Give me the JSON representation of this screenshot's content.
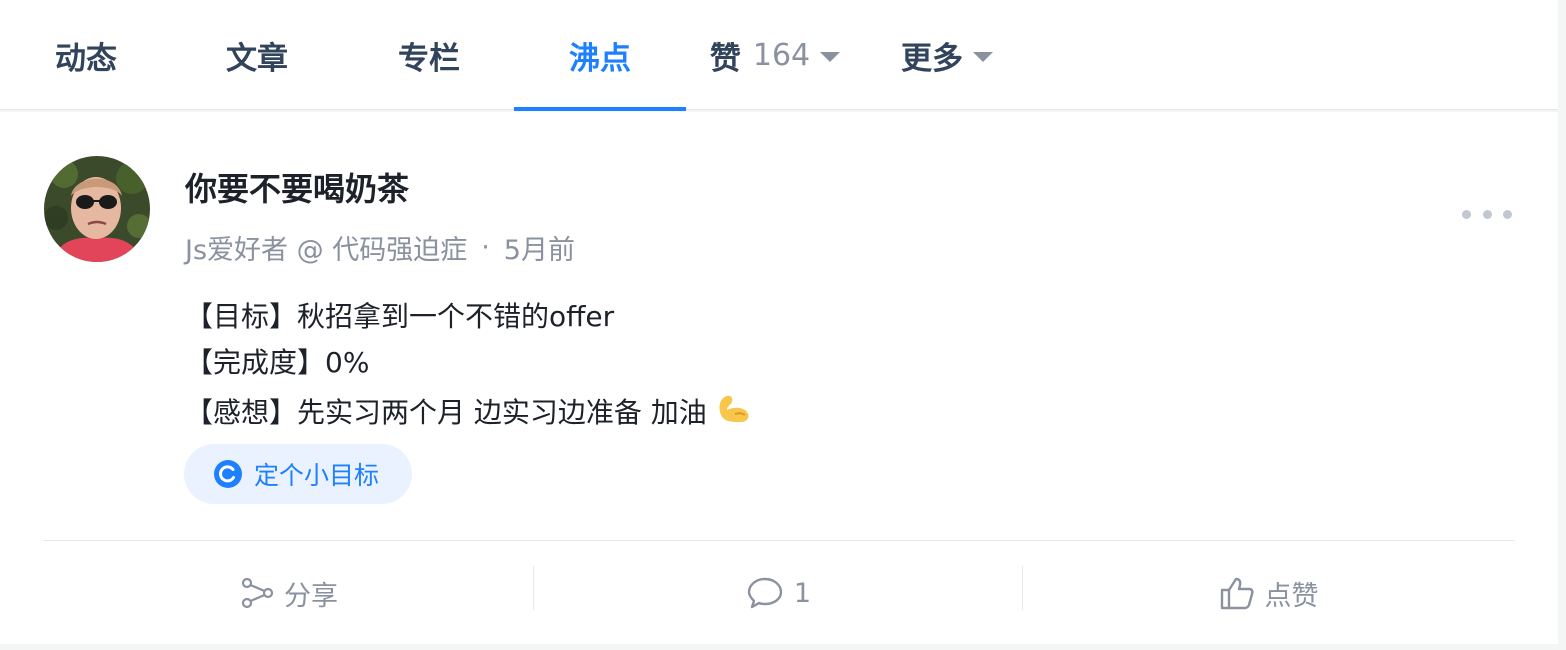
{
  "tabs": [
    {
      "label": "动态"
    },
    {
      "label": "文章"
    },
    {
      "label": "专栏"
    },
    {
      "label": "沸点",
      "active": true
    },
    {
      "label": "赞",
      "count": "164"
    },
    {
      "label": "更多"
    }
  ],
  "post": {
    "author": "你要不要喝奶茶",
    "title_info": "Js爱好者 @ 代码强迫症",
    "separator": "·",
    "time": "5月前",
    "lines": [
      "【目标】秋招拿到一个不错的offer",
      "【完成度】0%",
      "【感想】先实习两个月 边实习边准备 加油"
    ],
    "emoji": "💪",
    "topic": "定个小目标"
  },
  "actions": {
    "share": "分享",
    "comment_count": "1",
    "like": "点赞"
  },
  "colors": {
    "accent": "#1e80ff",
    "text": "#1d2129",
    "muted": "#8a919f",
    "tab_text": "#31445b"
  }
}
